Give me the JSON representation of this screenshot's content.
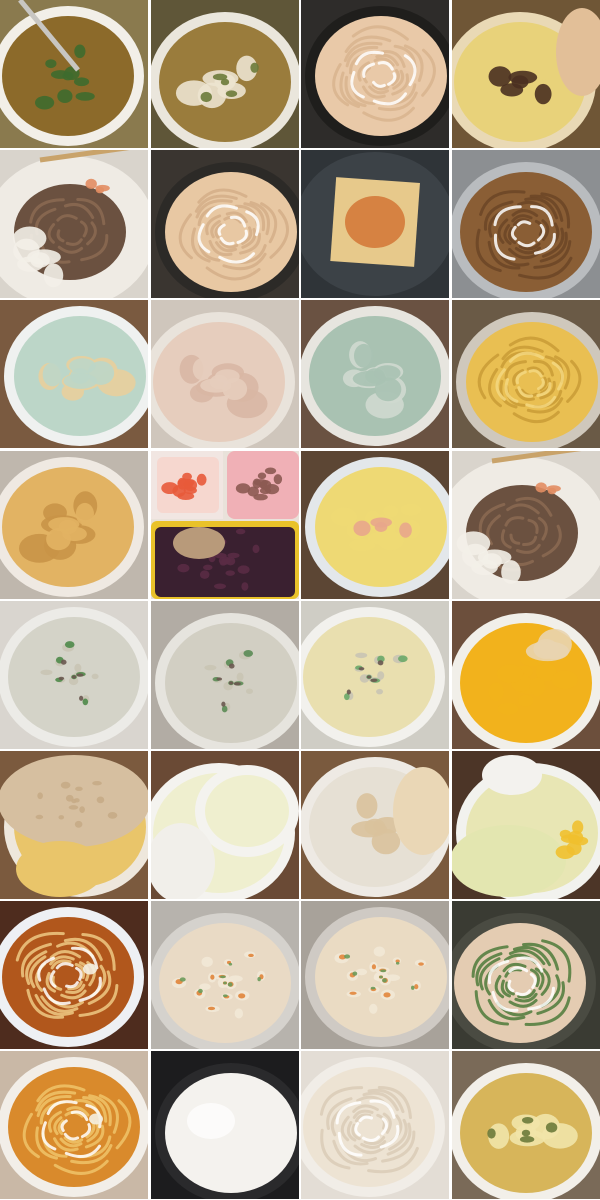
{
  "gallery": {
    "photos": [
      {
        "subject": "noodle-soup-with-greens",
        "bg": "#8a7a4e",
        "bowl": "#f2efe8",
        "food": "#8c6a2a",
        "accent": "#3e6b2e",
        "kind": "soup"
      },
      {
        "subject": "tofu-vegetable-soup",
        "bg": "#5f5638",
        "bowl": "#eae6dc",
        "food": "#9a7c3c",
        "accent": "#ece3cf",
        "kind": "tofu-soup"
      },
      {
        "subject": "plain-noodles-dark-bowl",
        "bg": "#2e2c2a",
        "bowl": "#1f1e1c",
        "food": "#e9c9a8",
        "accent": "#d8b48e",
        "kind": "noodles"
      },
      {
        "subject": "cabbage-mushroom-stew",
        "bg": "#6f5636",
        "bowl": "#e9d9b5",
        "food": "#e8d27a",
        "accent": "#4a3020",
        "kind": "stew"
      },
      {
        "subject": "mixed-soba-plate",
        "bg": "#d9d4cc",
        "bowl": "#efebe4",
        "food": "#6b5140",
        "accent": "#e28d62",
        "kind": "mixed"
      },
      {
        "subject": "noodles-in-wok",
        "bg": "#3a3530",
        "bowl": "#2c2a27",
        "food": "#e8c8a3",
        "accent": "#d4ae88",
        "kind": "noodles"
      },
      {
        "subject": "instant-noodle-block-seasoning",
        "bg": "#2f3438",
        "bowl": "#3c4247",
        "food": "#e7c98b",
        "accent": "#d47a3a",
        "kind": "block"
      },
      {
        "subject": "fried-noodles-container",
        "bg": "#8c8f92",
        "bowl": "#b9bcbf",
        "food": "#8a5e35",
        "accent": "#6b4526",
        "kind": "noodles"
      },
      {
        "subject": "dumplings-and-noodles",
        "bg": "#7a5a40",
        "bowl": "#eff1f0",
        "food": "#bcd6c8",
        "accent": "#e8cf9c",
        "kind": "dumplings"
      },
      {
        "subject": "sliced-tofu-skin",
        "bg": "#cfc6bc",
        "bowl": "#e9e3db",
        "food": "#e6cdbd",
        "accent": "#d8b7a4",
        "kind": "slices"
      },
      {
        "subject": "green-dumplings-bowl",
        "bg": "#6a5242",
        "bowl": "#e7e5df",
        "food": "#a9c2b2",
        "accent": "#cfd9cf",
        "kind": "dumplings"
      },
      {
        "subject": "potato-shreds-container",
        "bg": "#6a5a46",
        "bowl": "#cfc8bc",
        "food": "#e9bf52",
        "accent": "#c99b36",
        "kind": "shreds"
      },
      {
        "subject": "fried-tofu-bowl",
        "bg": "#bfb7ad",
        "bowl": "#efe9e2",
        "food": "#e2b363",
        "accent": "#c99447",
        "kind": "tofu"
      },
      {
        "subject": "bento-tomato-meat-rice",
        "bg": "#e9e2da",
        "bowl": "#f0b0b6",
        "food": "#3a2030",
        "accent": "#e85a3a",
        "kind": "bento"
      },
      {
        "subject": "shrimp-egg-container",
        "bg": "#5c4634",
        "bowl": "#e3e7ea",
        "food": "#eed974",
        "accent": "#e8a68c",
        "kind": "egg"
      },
      {
        "subject": "mixed-soba-plate-2",
        "bg": "#d9d4cc",
        "bowl": "#efebe4",
        "food": "#6b5140",
        "accent": "#e28d62",
        "kind": "mixed"
      },
      {
        "subject": "rice-porridge",
        "bg": "#d9d5cf",
        "bowl": "#ecebe7",
        "food": "#d4d3c8",
        "accent": "#4f8a4a",
        "kind": "porridge"
      },
      {
        "subject": "rice-porridge-2",
        "bg": "#b2aca4",
        "bowl": "#e6e4de",
        "food": "#d2cfc3",
        "accent": "#5b8b55",
        "kind": "porridge"
      },
      {
        "subject": "millet-porridge",
        "bg": "#cfcdc5",
        "bowl": "#f2f1ed",
        "food": "#e9dfaf",
        "accent": "#6ba869",
        "kind": "porridge"
      },
      {
        "subject": "scrambled-egg-bread",
        "bg": "#6c4f3c",
        "bowl": "#f1efe9",
        "food": "#f2b21c",
        "accent": "#e9d4b0",
        "kind": "egg-bread"
      },
      {
        "subject": "pancake-fried-tofu",
        "bg": "#7b5a3e",
        "bowl": "#eee7dc",
        "food": "#e9c56a",
        "accent": "#d6bfa0",
        "kind": "pancake"
      },
      {
        "subject": "milk-bowl-taro",
        "bg": "#6a4a35",
        "bowl": "#f4f3ef",
        "food": "#efefcf",
        "accent": "#ecebe4",
        "kind": "milk"
      },
      {
        "subject": "radish-soup-bowl",
        "bg": "#7a5a3e",
        "bowl": "#eeeae4",
        "food": "#e6e0d4",
        "accent": "#d9c29c",
        "kind": "radish"
      },
      {
        "subject": "egg-bowl-and-soup",
        "bg": "#4c3527",
        "bowl": "#f2f2ee",
        "food": "#e8e6b4",
        "accent": "#efc02f",
        "kind": "egg-soup"
      },
      {
        "subject": "instant-noodle-soup",
        "bg": "#4e2c1e",
        "bowl": "#eef0f4",
        "food": "#b1571c",
        "accent": "#efc984",
        "kind": "ramen"
      },
      {
        "subject": "fried-rice-veg",
        "bg": "#b7b3ad",
        "bowl": "#d5d2cd",
        "food": "#e9dac5",
        "accent": "#e0843a",
        "kind": "fried-rice"
      },
      {
        "subject": "fried-rice-veg-2",
        "bg": "#a8a29a",
        "bowl": "#cfcac4",
        "food": "#eadbc3",
        "accent": "#e2863c",
        "kind": "fried-rice"
      },
      {
        "subject": "noodles-with-greens",
        "bg": "#3a3b33",
        "bowl": "#4a4b42",
        "food": "#e4ccb2",
        "accent": "#4d7a3a",
        "kind": "noodles"
      },
      {
        "subject": "instant-noodle-bowl",
        "bg": "#c9b8a6",
        "bowl": "#f2eee8",
        "food": "#d98a2c",
        "accent": "#efc36a",
        "kind": "ramen"
      },
      {
        "subject": "steamed-bun",
        "bg": "#1c1c1e",
        "bowl": "#2a2a2c",
        "food": "#f4f2ee",
        "accent": "#e5d9a8",
        "kind": "bun"
      },
      {
        "subject": "plain-wheat-noodles",
        "bg": "#e3ddd5",
        "bowl": "#f1ede7",
        "food": "#ede3d3",
        "accent": "#d9cbb6",
        "kind": "noodles"
      },
      {
        "subject": "tofu-clear-soup",
        "bg": "#7a6a58",
        "bowl": "#f2efe9",
        "food": "#d7b55a",
        "accent": "#f1e4a8",
        "kind": "tofu-soup"
      }
    ]
  }
}
